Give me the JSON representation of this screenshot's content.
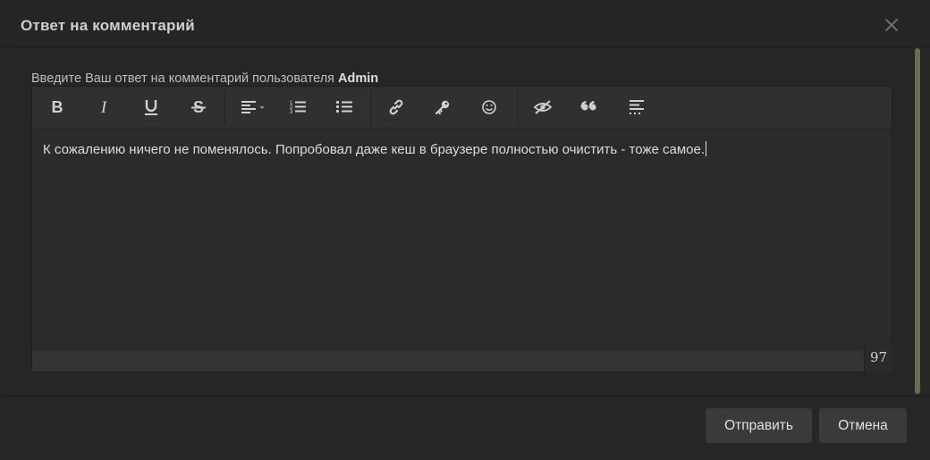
{
  "dialog": {
    "title": "Ответ на комментарий",
    "close_icon": "close-icon"
  },
  "form": {
    "label_prefix": "Введите Ваш ответ на комментарий пользователя ",
    "label_user": "Admin",
    "text": "К сожалению ничего не поменялось. Попробовал даже кеш в браузере полностью очистить - тоже самое.",
    "char_counter": "97"
  },
  "toolbar": {
    "buttons": [
      {
        "icon": "bold-icon"
      },
      {
        "icon": "italic-icon"
      },
      {
        "icon": "underline-icon"
      },
      {
        "icon": "strikethrough-icon"
      },
      {
        "icon": "align-left-dropdown-icon"
      },
      {
        "icon": "ordered-list-icon"
      },
      {
        "icon": "bullet-list-icon"
      },
      {
        "icon": "link-icon"
      },
      {
        "icon": "key-icon"
      },
      {
        "icon": "smile-icon"
      },
      {
        "icon": "hide-eye-icon"
      },
      {
        "icon": "quote-icon"
      },
      {
        "icon": "spoiler-lines-icon"
      }
    ]
  },
  "footer": {
    "send_label": "Отправить",
    "cancel_label": "Отмена"
  },
  "colors": {
    "background": "#262626",
    "scrollbar": "#6c6a52",
    "button": "#3a3a3a"
  }
}
